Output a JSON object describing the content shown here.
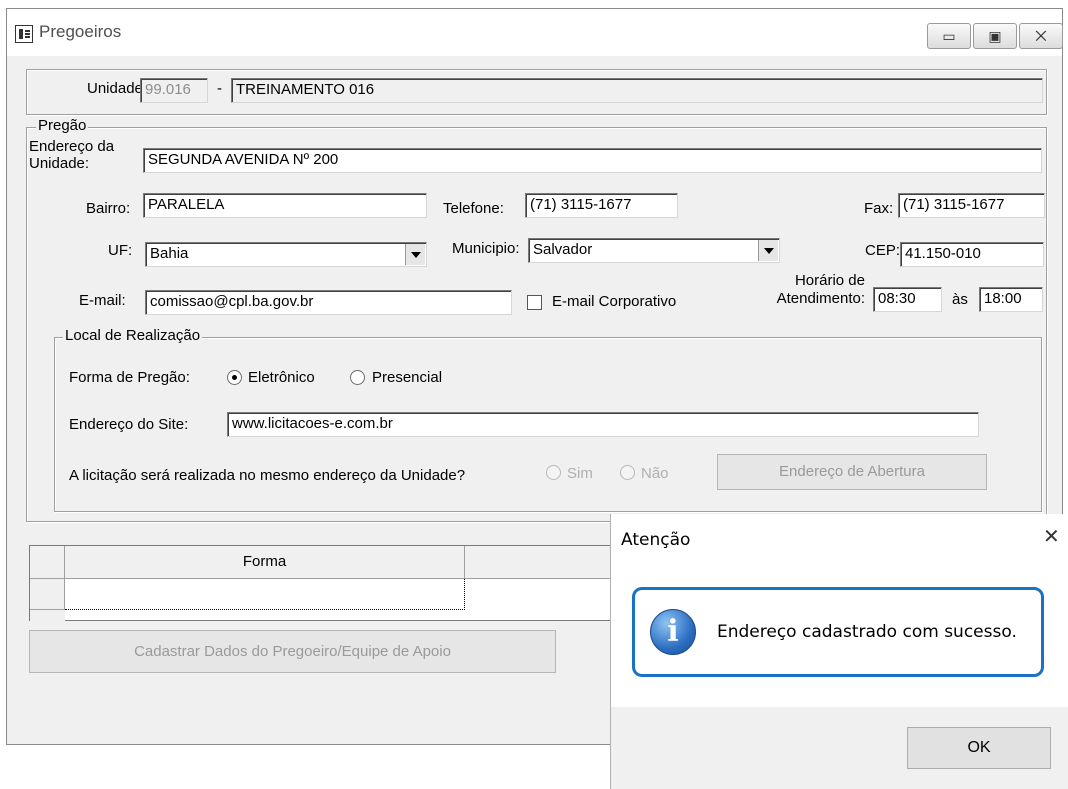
{
  "window": {
    "title": "Pregoeiros",
    "controls": {
      "minimize": "▭",
      "maximize": "▣",
      "close": "⨉"
    }
  },
  "unidade": {
    "label": "Unidade:",
    "code": "99.016",
    "separator": "-",
    "name": "TREINAMENTO 016"
  },
  "pregao": {
    "legend": "Pregão",
    "endereco_label_1": "Endereço da",
    "endereco_label_2": "Unidade:",
    "endereco_value": "SEGUNDA AVENIDA Nº 200",
    "bairro_label": "Bairro:",
    "bairro_value": "PARALELA",
    "telefone_label": "Telefone:",
    "telefone_value": "(71) 3115-1677",
    "fax_label": "Fax:",
    "fax_value": "(71) 3115-1677",
    "uf_label": "UF:",
    "uf_value": "Bahia",
    "municipio_label": "Municipio:",
    "municipio_value": "Salvador",
    "cep_label": "CEP:",
    "cep_value": "41.150-010",
    "email_label": "E-mail:",
    "email_value": "comissao@cpl.ba.gov.br",
    "email_corporativo_label": "E-mail Corporativo",
    "email_corporativo_checked": false,
    "horario_label_1": "Horário de",
    "horario_label_2": "Atendimento:",
    "horario_inicio": "08:30",
    "horario_sep": "às",
    "horario_fim": "18:00"
  },
  "local": {
    "legend": "Local de Realização",
    "forma_label": "Forma de Pregão:",
    "forma_eletronico": "Eletrônico",
    "forma_presencial": "Presencial",
    "forma_selected": "Eletrônico",
    "site_label": "Endereço do Site:",
    "site_value": "www.licitacoes-e.com.br",
    "mesmo_endereco_label": "A licitação será realizada no mesmo endereço da Unidade?",
    "sim_label": "Sim",
    "nao_label": "Não",
    "abertura_button": "Endereço de Abertura"
  },
  "grid": {
    "columns": [
      "Forma"
    ]
  },
  "cadastrar_button": "Cadastrar Dados do Pregoeiro/Equipe de Apoio",
  "dialog": {
    "title": "Atenção",
    "close": "✕",
    "message": "Endereço cadastrado com sucesso.",
    "ok_label": "OK",
    "icon": "info-icon",
    "highlight_color": "#1a72c4"
  }
}
